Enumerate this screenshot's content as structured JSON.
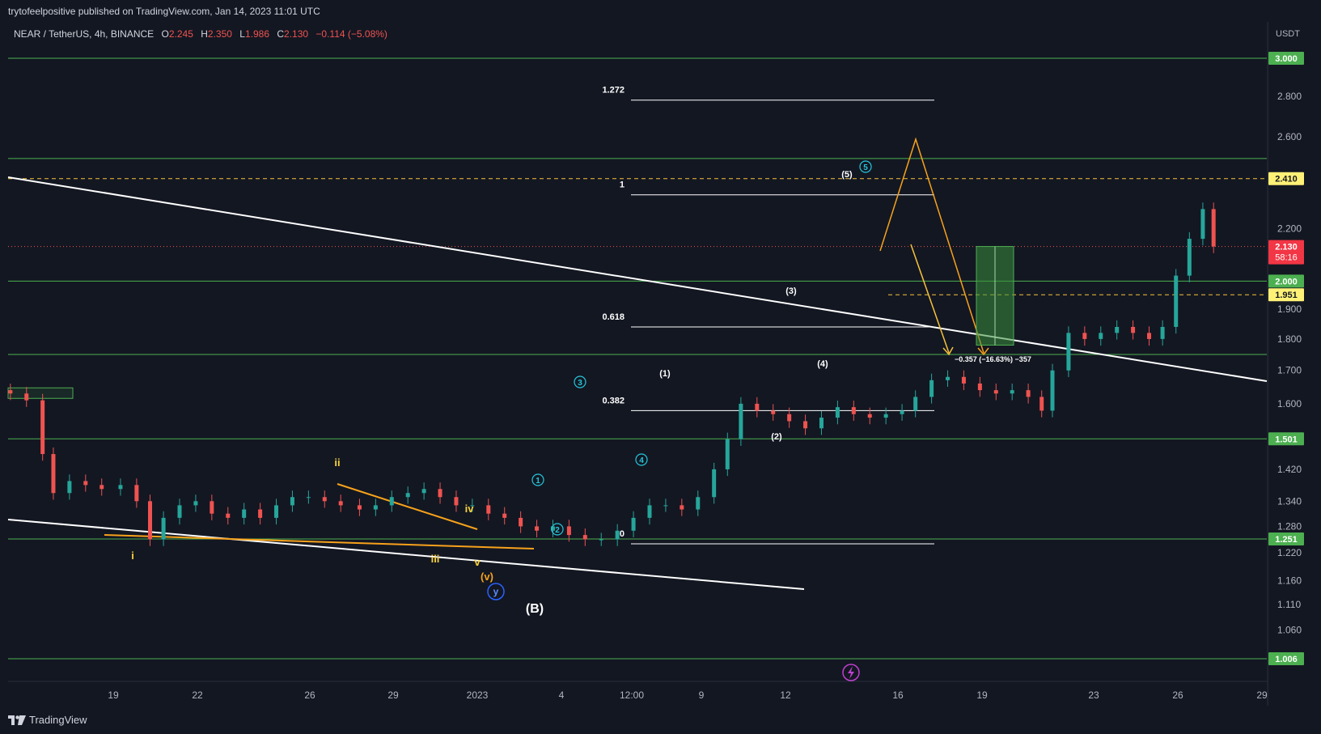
{
  "publisher": {
    "text": "trytofeelpositive published on TradingView.com, Jan 14, 2023 11:01 UTC"
  },
  "footer": {
    "brand": "TradingView"
  },
  "symbol_bar": {
    "symbol": "NEAR / TetherUS, 4h, BINANCE",
    "o_label": "O",
    "o": "2.245",
    "h_label": "H",
    "h": "2.350",
    "l_label": "L",
    "l": "1.986",
    "c_label": "C",
    "c": "2.130",
    "change": "−0.114 (−5.08%)"
  },
  "chart_data": {
    "type": "candlestick",
    "y_unit": "USDT",
    "x_ticks": [
      "19",
      "22",
      "26",
      "29",
      "2023",
      "4",
      "12:00",
      "9",
      "12",
      "16",
      "19",
      "23",
      "26",
      "29"
    ],
    "y_ticks": [
      "2.800",
      "2.600",
      "2.200",
      "1.900",
      "1.800",
      "1.700",
      "1.600",
      "1.420",
      "1.340",
      "1.280",
      "1.220",
      "1.160",
      "1.110",
      "1.060"
    ],
    "last_price": {
      "value": "2.130",
      "countdown": "58:16",
      "color": "#f23645"
    },
    "horizontal_levels": [
      {
        "value": 3.0,
        "label": "3.000",
        "color": "#4caf50"
      },
      {
        "value": 2.5,
        "label": "",
        "color": "#4caf50"
      },
      {
        "value": 2.0,
        "label": "2.000",
        "color": "#4caf50"
      },
      {
        "value": 1.75,
        "label": "",
        "color": "#4caf50"
      },
      {
        "value": 1.501,
        "label": "1.501",
        "color": "#4caf50"
      },
      {
        "value": 1.251,
        "label": "1.251",
        "color": "#4caf50"
      },
      {
        "value": 1.006,
        "label": "1.006",
        "color": "#4caf50"
      }
    ],
    "dashed_levels": [
      {
        "value": 2.41,
        "label": "2.410",
        "color": "#f7c23b"
      },
      {
        "value": 1.951,
        "label": "1.951",
        "color": "#f7c23b"
      }
    ],
    "fib_levels": [
      {
        "ratio": "1.272",
        "value": 2.78
      },
      {
        "ratio": "1",
        "value": 2.34
      },
      {
        "ratio": "0.618",
        "value": 1.84
      },
      {
        "ratio": "0.382",
        "value": 1.58
      },
      {
        "ratio": "0",
        "value": 1.24
      }
    ],
    "wave_labels": {
      "yellow": [
        "ii",
        "iv",
        "i",
        "iii",
        "v"
      ],
      "orange": [
        "(v)"
      ],
      "blue": [
        "y"
      ],
      "white": [
        "(B)",
        "(1)",
        "(2)",
        "(3)",
        "(4)",
        "(5)"
      ],
      "cyan": [
        "1",
        "2",
        "3",
        "4",
        "5"
      ]
    },
    "measure_label": "−0.357 (−16.63%) −357",
    "colors": {
      "up": "#26a69a",
      "down": "#ef5350",
      "level": "#4caf50",
      "dash": "#f7c23b",
      "projection": "#f7a21b",
      "trend": "#ffffff",
      "target_box": "#2e7d32"
    }
  }
}
